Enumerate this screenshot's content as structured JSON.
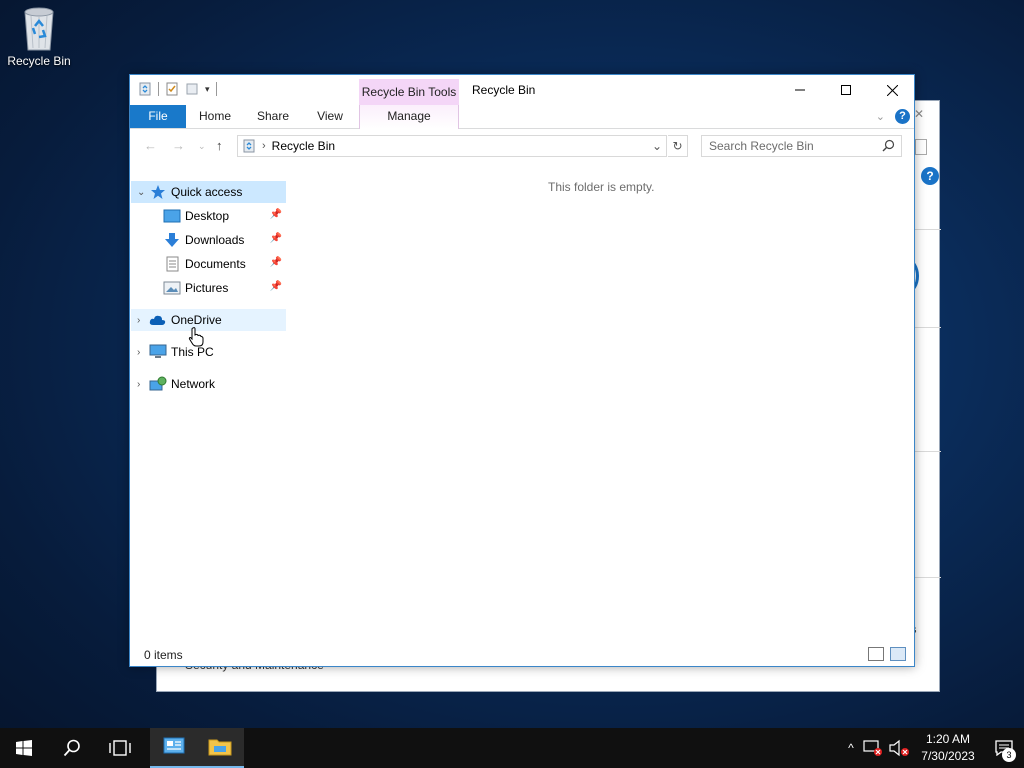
{
  "desktop": {
    "recycle_bin_label": "Recycle Bin"
  },
  "background_window": {
    "bottom_text": "Security and Maintenance",
    "right_text": "s"
  },
  "explorer": {
    "title": "Recycle Bin",
    "contextual_tab_group": "Recycle Bin Tools",
    "ribbon_tabs": {
      "file": "File",
      "home": "Home",
      "share": "Share",
      "view": "View",
      "manage": "Manage"
    },
    "address": {
      "crumb": "Recycle Bin"
    },
    "search": {
      "placeholder": "Search Recycle Bin"
    },
    "nav": {
      "quick_access": "Quick access",
      "desktop": "Desktop",
      "downloads": "Downloads",
      "documents": "Documents",
      "pictures": "Pictures",
      "onedrive": "OneDrive",
      "this_pc": "This PC",
      "network": "Network"
    },
    "empty_message": "This folder is empty.",
    "status": {
      "item_count": "0 items"
    }
  },
  "taskbar": {
    "time": "1:20 AM",
    "date": "7/30/2023",
    "notification_count": "3"
  },
  "colors": {
    "accent": "#1979ca",
    "contextual_tab": "#f4d6f7",
    "selection": "#cce8ff",
    "taskbar": "#101010"
  }
}
